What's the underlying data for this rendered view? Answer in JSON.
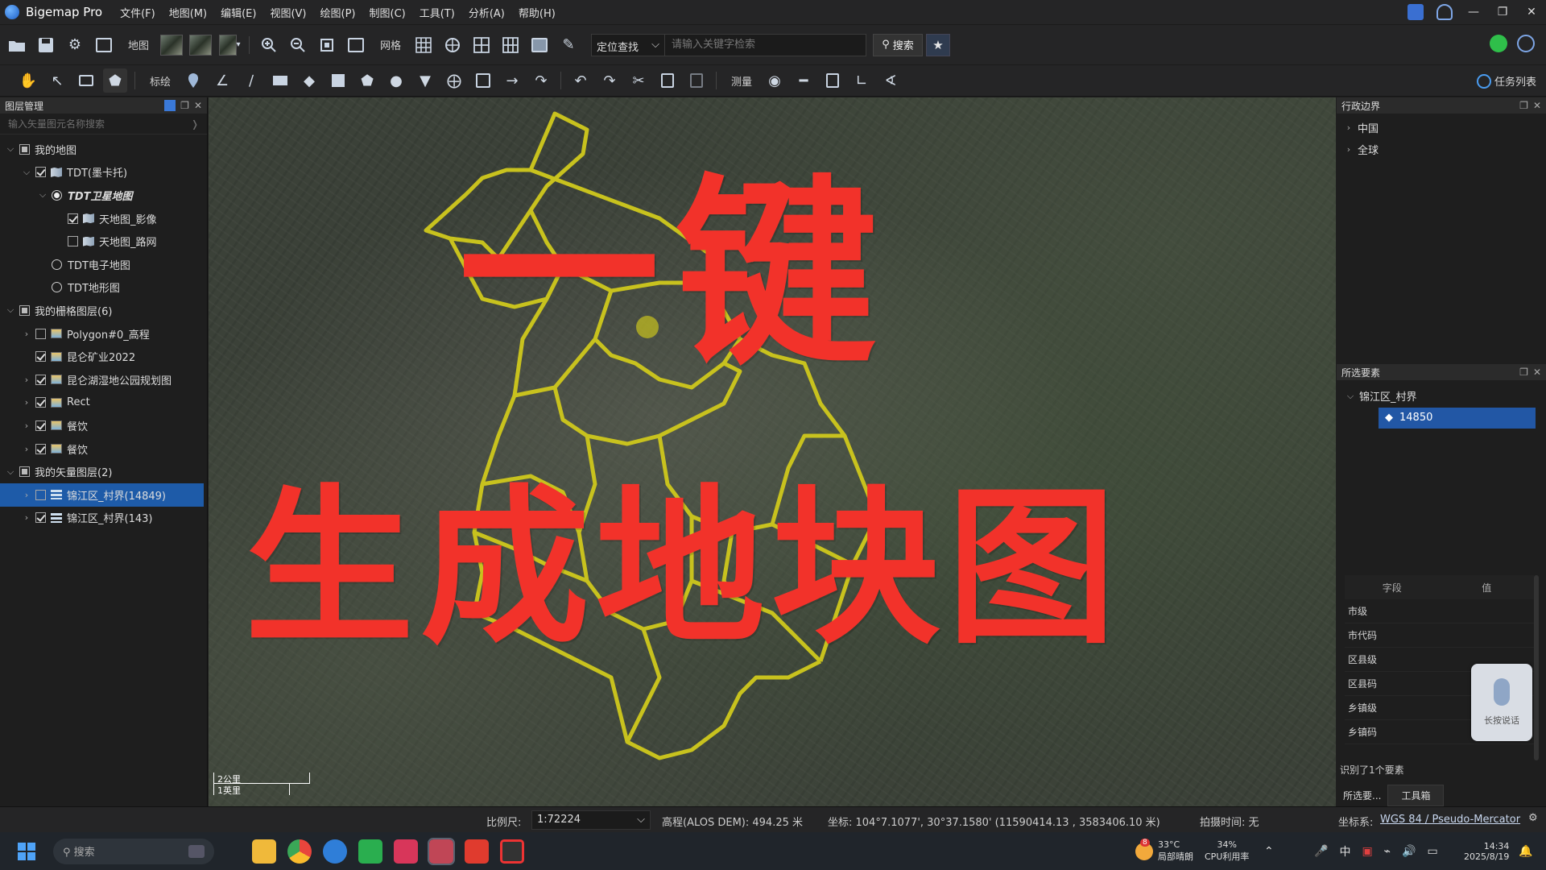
{
  "app": {
    "title": "Bigemap Pro",
    "menu": [
      "文件(F)",
      "地图(M)",
      "编辑(E)",
      "视图(V)",
      "绘图(P)",
      "制图(C)",
      "工具(T)",
      "分析(A)",
      "帮助(H)"
    ]
  },
  "toolbar1": {
    "map_label": "地图",
    "grid_label": "网格",
    "locate_combo": "定位查找",
    "search_placeholder": "请输入关键字检索",
    "search_button": "搜索"
  },
  "toolbar2": {
    "annotate_label": "标绘",
    "measure_label": "测量",
    "tasks_label": "任务列表"
  },
  "left_panel": {
    "title": "图层管理",
    "search_placeholder": "输入矢量图元名称搜索",
    "tree": [
      {
        "label": "我的地图",
        "level": 0,
        "expand": "open",
        "ctrl": "part",
        "icon": ""
      },
      {
        "label": "TDT(墨卡托)",
        "level": 1,
        "expand": "open",
        "ctrl": "on",
        "icon": "map"
      },
      {
        "label": "TDT卫星地图",
        "level": 2,
        "expand": "open",
        "ctrl": "radio-on",
        "icon": "",
        "style": "italic-bold"
      },
      {
        "label": "天地图_影像",
        "level": 3,
        "expand": "",
        "ctrl": "on",
        "icon": "map"
      },
      {
        "label": "天地图_路网",
        "level": 3,
        "expand": "",
        "ctrl": "off",
        "icon": "map"
      },
      {
        "label": "TDT电子地图",
        "level": 2,
        "expand": "",
        "ctrl": "radio-off",
        "icon": ""
      },
      {
        "label": "TDT地形图",
        "level": 2,
        "expand": "",
        "ctrl": "radio-off",
        "icon": ""
      },
      {
        "label": "我的栅格图层(6)",
        "level": 0,
        "expand": "open",
        "ctrl": "part",
        "icon": ""
      },
      {
        "label": "Polygon#0_高程",
        "level": 1,
        "expand": "closed",
        "ctrl": "off",
        "icon": "raster"
      },
      {
        "label": "昆仑矿业2022",
        "level": 1,
        "expand": "",
        "ctrl": "on",
        "icon": "raster"
      },
      {
        "label": "昆仑湖湿地公园规划图",
        "level": 1,
        "expand": "closed",
        "ctrl": "on",
        "icon": "raster"
      },
      {
        "label": "Rect",
        "level": 1,
        "expand": "closed",
        "ctrl": "on",
        "icon": "raster"
      },
      {
        "label": "餐饮",
        "level": 1,
        "expand": "closed",
        "ctrl": "on",
        "icon": "raster"
      },
      {
        "label": "餐饮",
        "level": 1,
        "expand": "closed",
        "ctrl": "on",
        "icon": "raster"
      },
      {
        "label": "我的矢量图层(2)",
        "level": 0,
        "expand": "open",
        "ctrl": "part",
        "icon": ""
      },
      {
        "label": "锦江区_村界(14849)",
        "level": 1,
        "expand": "closed",
        "ctrl": "off",
        "icon": "vector",
        "selected": true
      },
      {
        "label": "锦江区_村界(143)",
        "level": 1,
        "expand": "closed",
        "ctrl": "on",
        "icon": "vector"
      }
    ]
  },
  "map": {
    "overlay_line1": "一键",
    "overlay_line2": "生成地块图",
    "scale_km": "2公里",
    "scale_mi": "1英里"
  },
  "right_panel": {
    "admin_title": "行政边界",
    "admin_items": [
      "中国",
      "全球"
    ],
    "selected_title": "所选要素",
    "selected_group": "锦江区_村界",
    "selected_item": "14850",
    "field_header": "字段",
    "value_header": "值",
    "fields": [
      "市级",
      "市代码",
      "区县级",
      "区县码",
      "乡镇级",
      "乡镇码"
    ],
    "identified": "识别了1个要素",
    "tab_selected": "所选要...",
    "tab_toolbox": "工具箱",
    "voice_label": "长按说话"
  },
  "statusbar": {
    "scale_label": "比例尺:",
    "scale_value": "1:72224",
    "elevation": "高程(ALOS DEM): 494.25 米",
    "coords": "坐标: 104°7.1077', 30°37.1580'  (11590414.13 , 3583406.10 米)",
    "capture_time": "拍摄时间: 无",
    "crs_label": "坐标系:",
    "crs_value": "WGS 84 / Pseudo-Mercator"
  },
  "taskbar": {
    "search_label": "搜索",
    "weather_temp": "33°C",
    "weather_desc": "局部晴朗",
    "weather_badge": "8",
    "cpu_value": "34%",
    "cpu_label": "CPU利用率",
    "time": "14:34",
    "date": "2025/8/19"
  },
  "colors": {
    "overlay_red": "#f2322a",
    "boundary_yellow": "#c8c21e",
    "selection_blue": "#1e5ba8"
  }
}
